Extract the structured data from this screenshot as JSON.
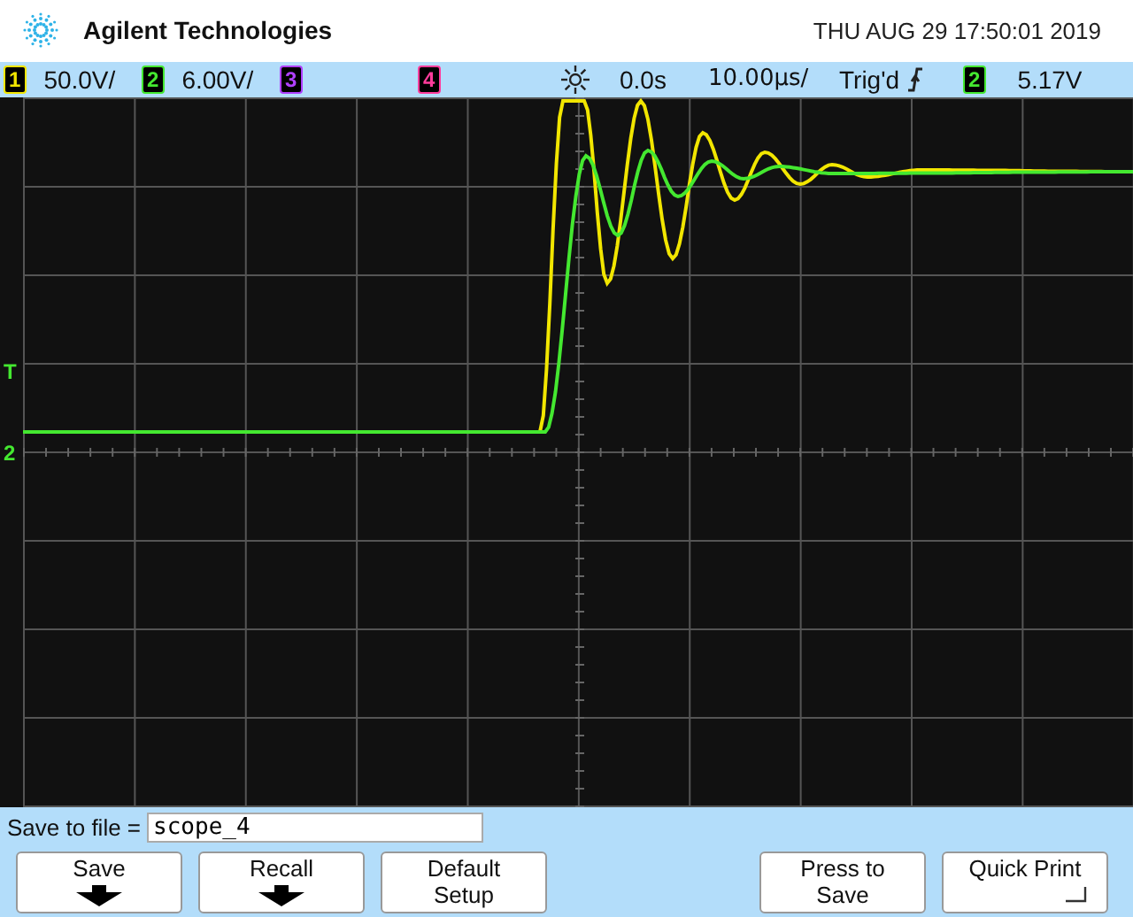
{
  "header": {
    "brand": "Agilent Technologies",
    "datetime": "THU AUG 29 17:50:01 2019"
  },
  "channels": [
    {
      "number": "1",
      "scale": "50.0V/",
      "color": "#f2e600"
    },
    {
      "number": "2",
      "scale": "6.00V/",
      "color": "#44e830"
    },
    {
      "number": "3",
      "color": "#b040ff"
    },
    {
      "number": "4",
      "color": "#ff3c9c"
    }
  ],
  "timebase": {
    "delay": "0.0s",
    "scale": "10.00µs/"
  },
  "trigger": {
    "status": "Trig'd",
    "source": "2",
    "color": "#44e830",
    "level": "5.17V"
  },
  "markers": [
    {
      "label": "T",
      "color": "#44e830"
    },
    {
      "label": "2",
      "color": "#44e830"
    }
  ],
  "save": {
    "label": "Save to file =",
    "value": "scope_4"
  },
  "softkeys": [
    {
      "label": "Save",
      "kind": "menu"
    },
    {
      "label": "Recall",
      "kind": "menu"
    },
    {
      "label": "Default Setup",
      "kind": "plain"
    },
    {
      "kind": "empty"
    },
    {
      "label": "Press to Save",
      "kind": "plain"
    },
    {
      "label": "Quick Print",
      "kind": "corner"
    }
  ]
}
